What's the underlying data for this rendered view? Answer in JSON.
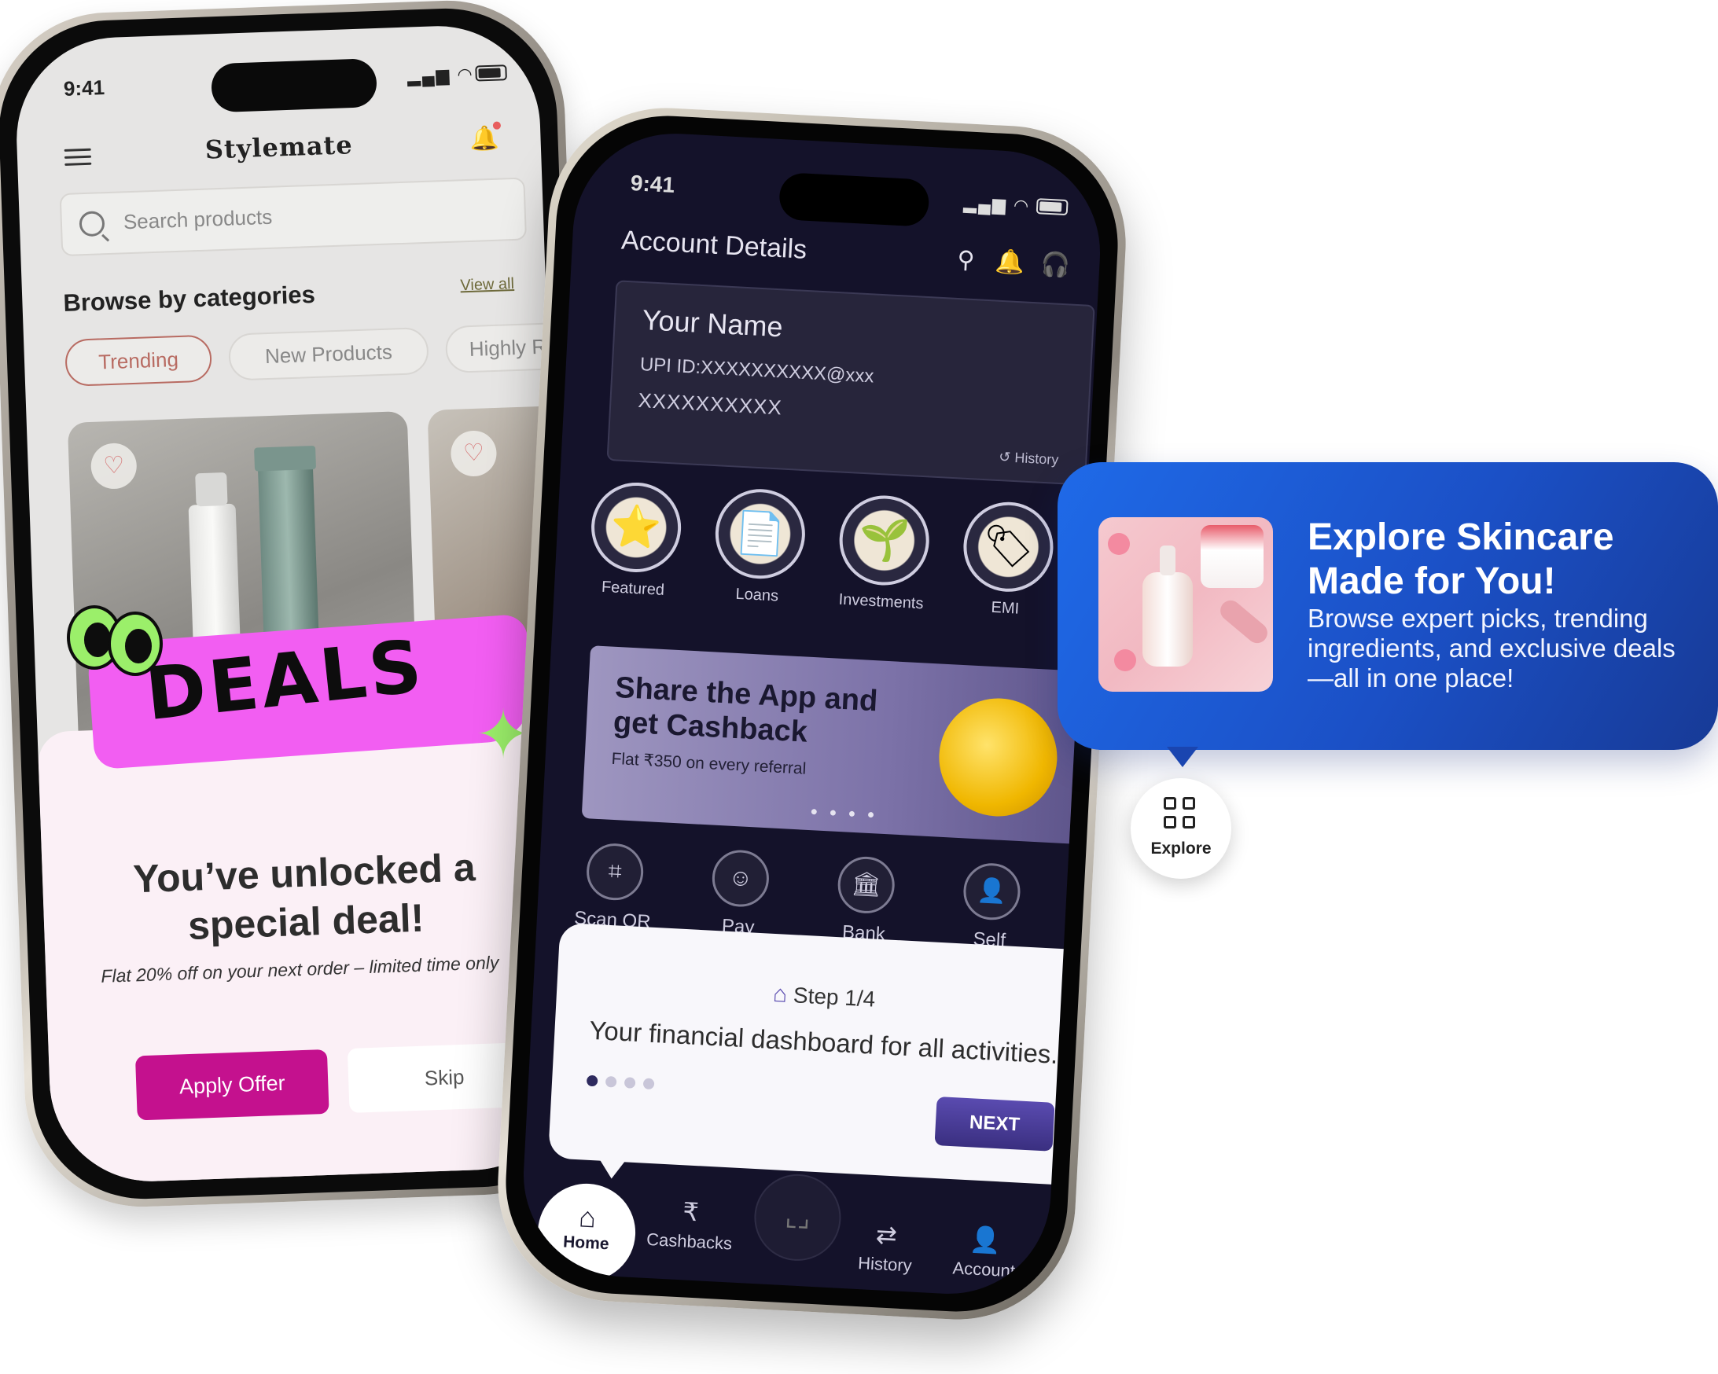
{
  "left_phone": {
    "status_time": "9:41",
    "brand": "Stylemate",
    "search_placeholder": "Search products",
    "section_title": "Browse by categories",
    "view_all": "View all",
    "chips": [
      "Trending",
      "New Products",
      "Highly Ra"
    ],
    "badge": "DEALS",
    "deal_title_line1": "You’ve unlocked a",
    "deal_title_line2": "special deal!",
    "deal_subtitle": "Flat 20% off on your next order – limited time only",
    "apply_label": "Apply Offer",
    "skip_label": "Skip",
    "accent_color": "#c4118e"
  },
  "right_phone": {
    "status_time": "9:41",
    "title": "Account Details",
    "card": {
      "name": "Your Name",
      "upi": "UPI ID:XXXXXXXXXX@xxx",
      "account": "XXXXXXXXXX",
      "history": "History"
    },
    "categories": [
      "Featured",
      "Loans",
      "Investments",
      "EMI"
    ],
    "banner": {
      "title_line1": "Share the App and",
      "title_line2": "get Cashback",
      "subtitle": "Flat ₹350 on every referral"
    },
    "actions": [
      "Scan QR",
      "Pay",
      "Bank",
      "Self"
    ],
    "step": {
      "label": "Step 1/4",
      "description": "Your financial dashboard for all activities.",
      "total_steps": 4,
      "current_step": 1,
      "next_label": "NEXT"
    },
    "nav": [
      "Home",
      "Cashbacks",
      "History",
      "Account"
    ]
  },
  "tooltip": {
    "title_line1": "Explore Skincare",
    "title_line2": "Made for You!",
    "description": "Browse expert picks, trending ingredients, and exclusive deals —all in one place!",
    "explore_label": "Explore",
    "color": "#1b50c6"
  }
}
